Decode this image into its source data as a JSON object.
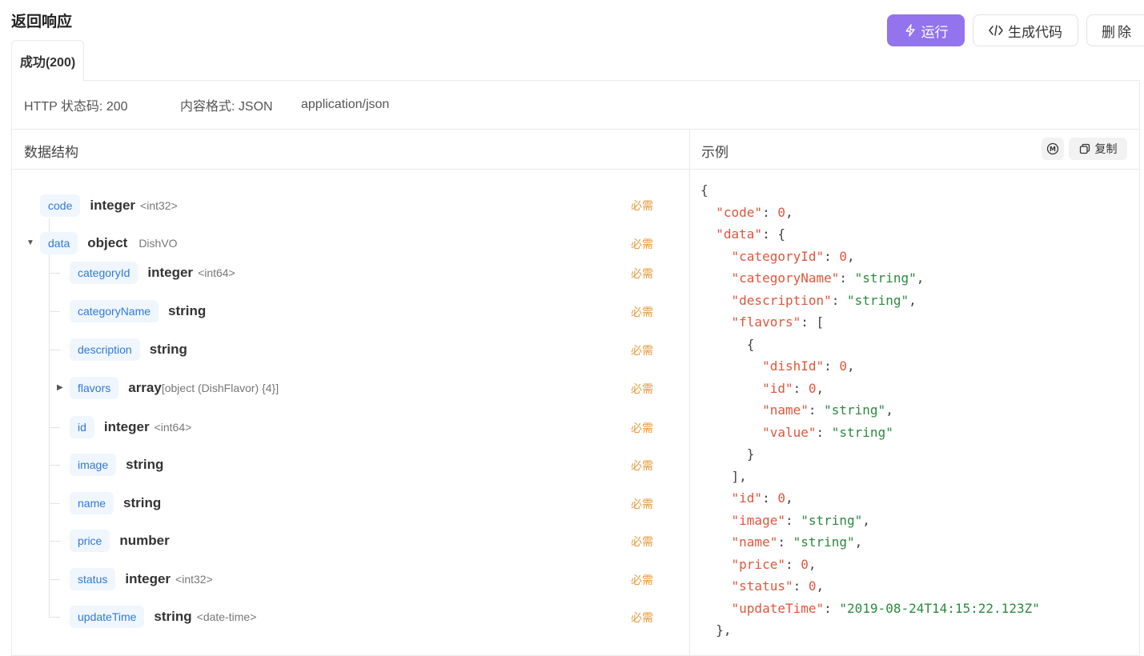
{
  "section_title": "返回响应",
  "toolbar": {
    "run_label": "运行",
    "gen_code_label": "生成代码",
    "delete_label": "删除"
  },
  "tab": {
    "label": "成功(200)"
  },
  "meta": {
    "status_code": "HTTP 状态码: 200",
    "content_format": "内容格式: JSON",
    "mime": "application/json"
  },
  "schema": {
    "header": "数据结构",
    "required_label": "必需",
    "fields": [
      {
        "name": "code",
        "type": "integer",
        "format": "<int32>"
      },
      {
        "name": "data",
        "type": "object",
        "format": "DishVO"
      },
      {
        "name": "categoryId",
        "type": "integer",
        "format": "<int64>"
      },
      {
        "name": "categoryName",
        "type": "string",
        "format": ""
      },
      {
        "name": "description",
        "type": "string",
        "format": ""
      },
      {
        "name": "flavors",
        "type": "array",
        "format": "[object (DishFlavor) {4}]"
      },
      {
        "name": "id",
        "type": "integer",
        "format": "<int64>"
      },
      {
        "name": "image",
        "type": "string",
        "format": ""
      },
      {
        "name": "name",
        "type": "string",
        "format": ""
      },
      {
        "name": "price",
        "type": "number",
        "format": ""
      },
      {
        "name": "status",
        "type": "integer",
        "format": "<int32>"
      },
      {
        "name": "updateTime",
        "type": "string",
        "format": "<date-time>"
      }
    ]
  },
  "example": {
    "header": "示例",
    "copy_label": "复制",
    "m_label": "M",
    "lines": [
      [
        [
          "p",
          "{"
        ]
      ],
      [
        [
          "p",
          "  "
        ],
        [
          "k",
          "\"code\""
        ],
        [
          "p",
          ": "
        ],
        [
          "n",
          "0"
        ],
        [
          "p",
          ","
        ]
      ],
      [
        [
          "p",
          "  "
        ],
        [
          "k",
          "\"data\""
        ],
        [
          "p",
          ": {"
        ]
      ],
      [
        [
          "p",
          "    "
        ],
        [
          "k",
          "\"categoryId\""
        ],
        [
          "p",
          ": "
        ],
        [
          "n",
          "0"
        ],
        [
          "p",
          ","
        ]
      ],
      [
        [
          "p",
          "    "
        ],
        [
          "k",
          "\"categoryName\""
        ],
        [
          "p",
          ": "
        ],
        [
          "s",
          "\"string\""
        ],
        [
          "p",
          ","
        ]
      ],
      [
        [
          "p",
          "    "
        ],
        [
          "k",
          "\"description\""
        ],
        [
          "p",
          ": "
        ],
        [
          "s",
          "\"string\""
        ],
        [
          "p",
          ","
        ]
      ],
      [
        [
          "p",
          "    "
        ],
        [
          "k",
          "\"flavors\""
        ],
        [
          "p",
          ": ["
        ]
      ],
      [
        [
          "p",
          "      {"
        ]
      ],
      [
        [
          "p",
          "        "
        ],
        [
          "k",
          "\"dishId\""
        ],
        [
          "p",
          ": "
        ],
        [
          "n",
          "0"
        ],
        [
          "p",
          ","
        ]
      ],
      [
        [
          "p",
          "        "
        ],
        [
          "k",
          "\"id\""
        ],
        [
          "p",
          ": "
        ],
        [
          "n",
          "0"
        ],
        [
          "p",
          ","
        ]
      ],
      [
        [
          "p",
          "        "
        ],
        [
          "k",
          "\"name\""
        ],
        [
          "p",
          ": "
        ],
        [
          "s",
          "\"string\""
        ],
        [
          "p",
          ","
        ]
      ],
      [
        [
          "p",
          "        "
        ],
        [
          "k",
          "\"value\""
        ],
        [
          "p",
          ": "
        ],
        [
          "s",
          "\"string\""
        ]
      ],
      [
        [
          "p",
          "      }"
        ]
      ],
      [
        [
          "p",
          "    ],"
        ]
      ],
      [
        [
          "p",
          "    "
        ],
        [
          "k",
          "\"id\""
        ],
        [
          "p",
          ": "
        ],
        [
          "n",
          "0"
        ],
        [
          "p",
          ","
        ]
      ],
      [
        [
          "p",
          "    "
        ],
        [
          "k",
          "\"image\""
        ],
        [
          "p",
          ": "
        ],
        [
          "s",
          "\"string\""
        ],
        [
          "p",
          ","
        ]
      ],
      [
        [
          "p",
          "    "
        ],
        [
          "k",
          "\"name\""
        ],
        [
          "p",
          ": "
        ],
        [
          "s",
          "\"string\""
        ],
        [
          "p",
          ","
        ]
      ],
      [
        [
          "p",
          "    "
        ],
        [
          "k",
          "\"price\""
        ],
        [
          "p",
          ": "
        ],
        [
          "n",
          "0"
        ],
        [
          "p",
          ","
        ]
      ],
      [
        [
          "p",
          "    "
        ],
        [
          "k",
          "\"status\""
        ],
        [
          "p",
          ": "
        ],
        [
          "n",
          "0"
        ],
        [
          "p",
          ","
        ]
      ],
      [
        [
          "p",
          "    "
        ],
        [
          "k",
          "\"updateTime\""
        ],
        [
          "p",
          ": "
        ],
        [
          "s",
          "\"2019-08-24T14:15:22.123Z\""
        ]
      ],
      [
        [
          "p",
          "  },"
        ]
      ]
    ]
  }
}
